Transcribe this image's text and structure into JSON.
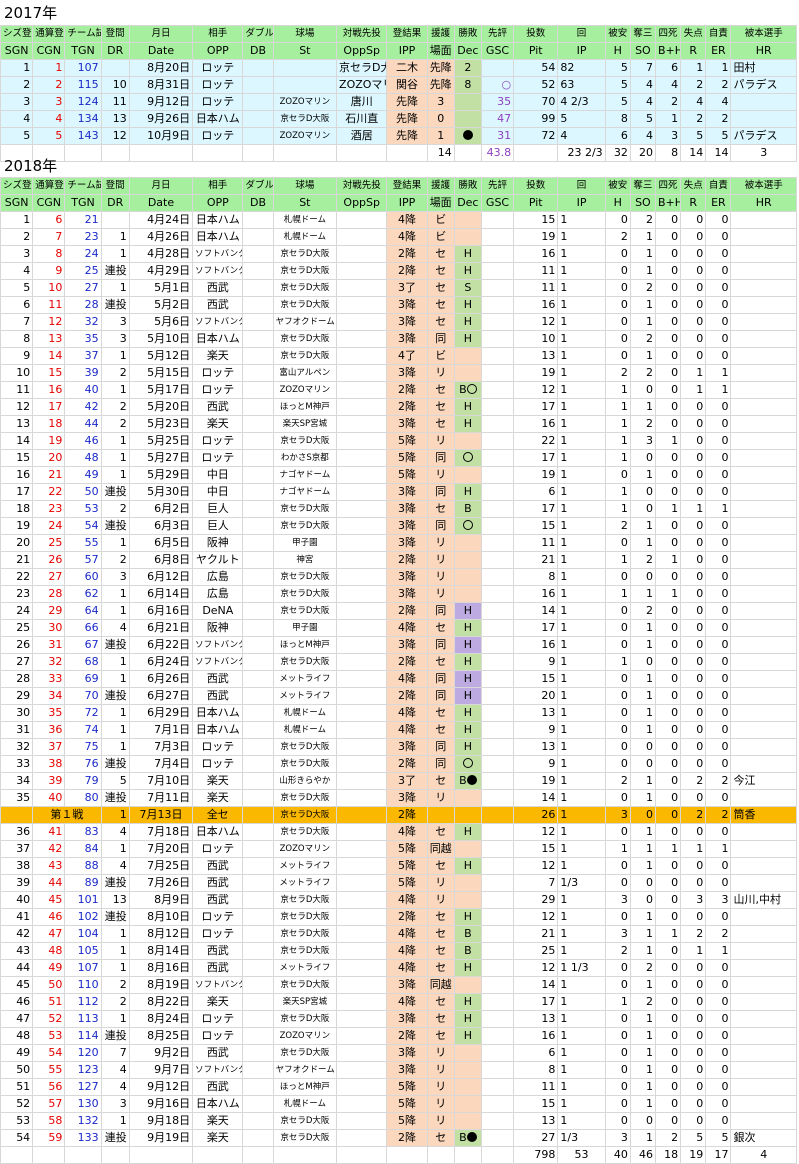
{
  "sec2017": {
    "title": "2017年"
  },
  "sec2018": {
    "title": "2018年"
  },
  "hdr": {
    "jp": [
      "シズ登",
      "通算登",
      "チーム試",
      "登間",
      "月日",
      "相手",
      "ダブル",
      "球場",
      "対戦先投",
      "登結果",
      "援護",
      "勝敗",
      "先評",
      "投数",
      "回",
      "被安",
      "奪三",
      "四死",
      "失点",
      "自責",
      "被本選手"
    ],
    "en": [
      "SGN",
      "CGN",
      "TGN",
      "DR",
      "Date",
      "OPP",
      "DB",
      "St",
      "OppSp",
      "IPP",
      "場面",
      "Dec",
      "GSC",
      "Pit",
      "IP",
      "H",
      "SO",
      "B+H",
      "R",
      "ER",
      "HR"
    ]
  },
  "rows2017": [
    [
      "1",
      "1",
      "107",
      "",
      "8月20日",
      "ロッテ",
      "",
      "京セラD大阪",
      "二木",
      "先降",
      "2",
      "",
      "54",
      "82",
      "5",
      "7",
      "6",
      "1",
      "1",
      "田村"
    ],
    [
      "2",
      "2",
      "115",
      "10",
      "8月31日",
      "ロッテ",
      "",
      "ZOZOマリン",
      "関谷",
      "先降",
      "8",
      "○",
      "52",
      "63",
      "5",
      "4",
      "4",
      "2",
      "2",
      "パラデス"
    ],
    [
      "3",
      "3",
      "124",
      "11",
      "9月12日",
      "ロッテ",
      "",
      "ZOZOマリン",
      "唐川",
      "先降",
      "3",
      "",
      "35",
      "70",
      "4 2/3",
      "5",
      "4",
      "2",
      "4",
      "4",
      ""
    ],
    [
      "4",
      "4",
      "134",
      "13",
      "9月26日",
      "日本ハム",
      "",
      "京セラD大阪",
      "石川直",
      "先降",
      "0",
      "",
      "47",
      "99",
      "5",
      "8",
      "5",
      "1",
      "2",
      "2",
      ""
    ],
    [
      "5",
      "5",
      "143",
      "12",
      "10月9日",
      "ロッテ",
      "",
      "ZOZOマリン",
      "酒居",
      "先降",
      "1",
      "●",
      "31",
      "72",
      "4",
      "6",
      "4",
      "3",
      "5",
      "5",
      "パラデス"
    ]
  ],
  "tot2017": {
    "rs": "14",
    "gsc": "43.8",
    "ip": "23 2/3",
    "h": "32",
    "so": "20",
    "bh": "8",
    "r": "14",
    "er": "14",
    "hr": "3"
  },
  "rows2018": [
    [
      "1",
      "6",
      "21",
      "",
      "4月24日",
      "日本ハム",
      "",
      "札幌ドーム",
      "",
      "4降",
      "ビ",
      "",
      "",
      "15",
      "1",
      "0",
      "2",
      "0",
      "0",
      "0",
      ""
    ],
    [
      "2",
      "7",
      "23",
      "1",
      "4月26日",
      "日本ハム",
      "",
      "札幌ドーム",
      "",
      "4降",
      "ビ",
      "",
      "",
      "19",
      "1",
      "2",
      "1",
      "0",
      "0",
      "0",
      ""
    ],
    [
      "3",
      "8",
      "24",
      "1",
      "4月28日",
      "ソフトバンク",
      "",
      "京セラD大阪",
      "",
      "2降",
      "セ",
      "H",
      "",
      "16",
      "1",
      "0",
      "1",
      "0",
      "0",
      "0",
      ""
    ],
    [
      "4",
      "9",
      "25",
      "連投",
      "4月29日",
      "ソフトバンク",
      "",
      "京セラD大阪",
      "",
      "2降",
      "セ",
      "H",
      "",
      "11",
      "1",
      "0",
      "1",
      "0",
      "0",
      "0",
      ""
    ],
    [
      "5",
      "10",
      "27",
      "1",
      "5月1日",
      "西武",
      "",
      "京セラD大阪",
      "",
      "3了",
      "セ",
      "S",
      "",
      "11",
      "1",
      "0",
      "2",
      "0",
      "0",
      "0",
      ""
    ],
    [
      "6",
      "11",
      "28",
      "連投",
      "5月2日",
      "西武",
      "",
      "京セラD大阪",
      "",
      "3降",
      "セ",
      "H",
      "",
      "16",
      "1",
      "0",
      "1",
      "0",
      "0",
      "0",
      ""
    ],
    [
      "7",
      "12",
      "32",
      "3",
      "5月6日",
      "ソフトバンク",
      "",
      "ヤフオクドーム",
      "",
      "3降",
      "セ",
      "H",
      "",
      "12",
      "1",
      "0",
      "1",
      "0",
      "0",
      "0",
      ""
    ],
    [
      "8",
      "13",
      "35",
      "3",
      "5月10日",
      "日本ハム",
      "",
      "京セラD大阪",
      "",
      "3降",
      "同",
      "H",
      "",
      "10",
      "1",
      "0",
      "2",
      "0",
      "0",
      "0",
      ""
    ],
    [
      "9",
      "14",
      "37",
      "1",
      "5月12日",
      "楽天",
      "",
      "京セラD大阪",
      "",
      "4了",
      "ビ",
      "",
      "",
      "13",
      "1",
      "0",
      "1",
      "0",
      "0",
      "0",
      ""
    ],
    [
      "10",
      "15",
      "39",
      "2",
      "5月15日",
      "ロッテ",
      "",
      "富山アルペン",
      "",
      "3降",
      "リ",
      "",
      "",
      "19",
      "1",
      "2",
      "2",
      "0",
      "1",
      "1",
      ""
    ],
    [
      "11",
      "16",
      "40",
      "1",
      "5月17日",
      "ロッテ",
      "",
      "ZOZOマリン",
      "",
      "2降",
      "セ",
      "B○",
      "",
      "12",
      "1",
      "1",
      "0",
      "0",
      "1",
      "1",
      ""
    ],
    [
      "12",
      "17",
      "42",
      "2",
      "5月20日",
      "西武",
      "",
      "ほっとM神戸",
      "",
      "2降",
      "セ",
      "H",
      "",
      "17",
      "1",
      "1",
      "1",
      "0",
      "0",
      "0",
      ""
    ],
    [
      "13",
      "18",
      "44",
      "2",
      "5月23日",
      "楽天",
      "",
      "楽天SP宮城",
      "",
      "3降",
      "セ",
      "H",
      "",
      "16",
      "1",
      "1",
      "2",
      "0",
      "0",
      "0",
      ""
    ],
    [
      "14",
      "19",
      "46",
      "1",
      "5月25日",
      "ロッテ",
      "",
      "京セラD大阪",
      "",
      "5降",
      "リ",
      "",
      "",
      "22",
      "1",
      "1",
      "3",
      "1",
      "0",
      "0",
      ""
    ],
    [
      "15",
      "20",
      "48",
      "1",
      "5月27日",
      "ロッテ",
      "",
      "わかさS京都",
      "",
      "5降",
      "同",
      "○",
      "",
      "17",
      "1",
      "1",
      "0",
      "0",
      "0",
      "0",
      ""
    ],
    [
      "16",
      "21",
      "49",
      "1",
      "5月29日",
      "中日",
      "",
      "ナゴヤドーム",
      "",
      "5降",
      "リ",
      "",
      "",
      "19",
      "1",
      "0",
      "1",
      "0",
      "0",
      "0",
      ""
    ],
    [
      "17",
      "22",
      "50",
      "連投",
      "5月30日",
      "中日",
      "",
      "ナゴヤドーム",
      "",
      "3降",
      "同",
      "H",
      "",
      "6",
      "1",
      "1",
      "0",
      "0",
      "0",
      "0",
      ""
    ],
    [
      "18",
      "23",
      "53",
      "2",
      "6月2日",
      "巨人",
      "",
      "京セラD大阪",
      "",
      "3降",
      "セ",
      "B",
      "",
      "17",
      "1",
      "1",
      "0",
      "1",
      "1",
      "1",
      ""
    ],
    [
      "19",
      "24",
      "54",
      "連投",
      "6月3日",
      "巨人",
      "",
      "京セラD大阪",
      "",
      "3降",
      "同",
      "○",
      "",
      "15",
      "1",
      "2",
      "1",
      "0",
      "0",
      "0",
      ""
    ],
    [
      "20",
      "25",
      "55",
      "1",
      "6月5日",
      "阪神",
      "",
      "甲子園",
      "",
      "3降",
      "リ",
      "",
      "",
      "11",
      "1",
      "0",
      "1",
      "0",
      "0",
      "0",
      ""
    ],
    [
      "21",
      "26",
      "57",
      "2",
      "6月8日",
      "ヤクルト",
      "",
      "神宮",
      "",
      "2降",
      "リ",
      "",
      "",
      "21",
      "1",
      "1",
      "2",
      "1",
      "0",
      "0",
      ""
    ],
    [
      "22",
      "27",
      "60",
      "3",
      "6月12日",
      "広島",
      "",
      "京セラD大阪",
      "",
      "3降",
      "リ",
      "",
      "",
      "8",
      "1",
      "0",
      "0",
      "0",
      "0",
      "0",
      ""
    ],
    [
      "23",
      "28",
      "62",
      "1",
      "6月14日",
      "広島",
      "",
      "京セラD大阪",
      "",
      "3降",
      "リ",
      "",
      "",
      "16",
      "1",
      "1",
      "1",
      "1",
      "0",
      "0",
      ""
    ],
    [
      "24",
      "29",
      "64",
      "1",
      "6月16日",
      "DeNA",
      "",
      "京セラD大阪",
      "",
      "2降",
      "同",
      "H",
      "",
      "14",
      "1",
      "0",
      "2",
      "0",
      "0",
      "0",
      ""
    ],
    [
      "25",
      "30",
      "66",
      "4",
      "6月21日",
      "阪神",
      "",
      "甲子園",
      "",
      "4降",
      "セ",
      "H",
      "",
      "17",
      "1",
      "0",
      "1",
      "0",
      "0",
      "0",
      ""
    ],
    [
      "26",
      "31",
      "67",
      "連投",
      "6月22日",
      "ソフトバンク",
      "",
      "ほっとM神戸",
      "",
      "3降",
      "同",
      "H",
      "",
      "16",
      "1",
      "0",
      "1",
      "0",
      "0",
      "0",
      ""
    ],
    [
      "27",
      "32",
      "68",
      "1",
      "6月24日",
      "ソフトバンク",
      "",
      "京セラD大阪",
      "",
      "2降",
      "セ",
      "H",
      "",
      "9",
      "1",
      "1",
      "0",
      "0",
      "0",
      "0",
      ""
    ],
    [
      "28",
      "33",
      "69",
      "1",
      "6月26日",
      "西武",
      "",
      "メットライフ",
      "",
      "4降",
      "同",
      "H",
      "",
      "15",
      "1",
      "0",
      "1",
      "0",
      "0",
      "0",
      ""
    ],
    [
      "29",
      "34",
      "70",
      "連投",
      "6月27日",
      "西武",
      "",
      "メットライフ",
      "",
      "2降",
      "同",
      "H",
      "",
      "20",
      "1",
      "0",
      "1",
      "0",
      "0",
      "0",
      ""
    ],
    [
      "30",
      "35",
      "72",
      "1",
      "6月29日",
      "日本ハム",
      "",
      "札幌ドーム",
      "",
      "4降",
      "セ",
      "H",
      "",
      "13",
      "1",
      "0",
      "1",
      "0",
      "0",
      "0",
      ""
    ],
    [
      "31",
      "36",
      "74",
      "1",
      "7月1日",
      "日本ハム",
      "",
      "札幌ドーム",
      "",
      "4降",
      "セ",
      "H",
      "",
      "9",
      "1",
      "0",
      "1",
      "0",
      "0",
      "0",
      ""
    ],
    [
      "32",
      "37",
      "75",
      "1",
      "7月3日",
      "ロッテ",
      "",
      "京セラD大阪",
      "",
      "3降",
      "同",
      "H",
      "",
      "13",
      "1",
      "0",
      "0",
      "0",
      "0",
      "0",
      ""
    ],
    [
      "33",
      "38",
      "76",
      "連投",
      "7月4日",
      "ロッテ",
      "",
      "京セラD大阪",
      "",
      "2降",
      "同",
      "○",
      "",
      "9",
      "1",
      "0",
      "0",
      "0",
      "0",
      "0",
      ""
    ],
    [
      "34",
      "39",
      "79",
      "5",
      "7月10日",
      "楽天",
      "",
      "山形きらやか",
      "",
      "3了",
      "セ",
      "B●",
      "",
      "19",
      "1",
      "2",
      "1",
      "0",
      "2",
      "2",
      "今江"
    ],
    [
      "35",
      "40",
      "80",
      "連投",
      "7月11日",
      "楽天",
      "",
      "京セラD大阪",
      "",
      "3降",
      "リ",
      "",
      "",
      "14",
      "1",
      "0",
      "1",
      "0",
      "0",
      "0",
      ""
    ]
  ],
  "asg": [
    "第１戦",
    "1",
    "7月13日",
    "全セ",
    "京セラD大阪",
    "2降",
    "26",
    "1",
    "3",
    "0",
    "0",
    "2",
    "2",
    "筒香"
  ],
  "rows2018b": [
    [
      "36",
      "41",
      "83",
      "4",
      "7月18日",
      "日本ハム",
      "",
      "京セラD大阪",
      "",
      "4降",
      "セ",
      "H",
      "",
      "12",
      "1",
      "0",
      "1",
      "0",
      "0",
      "0",
      ""
    ],
    [
      "37",
      "42",
      "84",
      "1",
      "7月20日",
      "ロッテ",
      "",
      "ZOZOマリン",
      "",
      "5降",
      "同越",
      "",
      "",
      "15",
      "1",
      "1",
      "1",
      "1",
      "1",
      "1",
      ""
    ],
    [
      "38",
      "43",
      "88",
      "4",
      "7月25日",
      "西武",
      "",
      "メットライフ",
      "",
      "5降",
      "セ",
      "H",
      "",
      "12",
      "1",
      "0",
      "1",
      "0",
      "0",
      "0",
      ""
    ],
    [
      "39",
      "44",
      "89",
      "連投",
      "7月26日",
      "西武",
      "",
      "メットライフ",
      "",
      "5降",
      "リ",
      "",
      "",
      "7",
      "1/3",
      "0",
      "0",
      "0",
      "0",
      "0",
      ""
    ],
    [
      "40",
      "45",
      "101",
      "13",
      "8月9日",
      "西武",
      "",
      "京セラD大阪",
      "",
      "4降",
      "リ",
      "",
      "",
      "29",
      "1",
      "3",
      "0",
      "0",
      "3",
      "3",
      "山川,中村"
    ],
    [
      "41",
      "46",
      "102",
      "連投",
      "8月10日",
      "ロッテ",
      "",
      "京セラD大阪",
      "",
      "2降",
      "セ",
      "H",
      "",
      "12",
      "1",
      "0",
      "1",
      "0",
      "0",
      "0",
      ""
    ],
    [
      "42",
      "47",
      "104",
      "1",
      "8月12日",
      "ロッテ",
      "",
      "京セラD大阪",
      "",
      "4降",
      "セ",
      "B",
      "",
      "21",
      "1",
      "3",
      "1",
      "1",
      "2",
      "2",
      ""
    ],
    [
      "43",
      "48",
      "105",
      "1",
      "8月14日",
      "西武",
      "",
      "京セラD大阪",
      "",
      "4降",
      "セ",
      "B",
      "",
      "25",
      "1",
      "2",
      "1",
      "0",
      "1",
      "1",
      ""
    ],
    [
      "44",
      "49",
      "107",
      "1",
      "8月16日",
      "西武",
      "",
      "メットライフ",
      "",
      "4降",
      "セ",
      "H",
      "",
      "12",
      "1 1/3",
      "0",
      "2",
      "0",
      "0",
      "0",
      ""
    ],
    [
      "45",
      "50",
      "110",
      "2",
      "8月19日",
      "ソフトバンク",
      "",
      "京セラD大阪",
      "",
      "3降",
      "同越",
      "",
      "",
      "14",
      "1",
      "0",
      "1",
      "0",
      "0",
      "0",
      ""
    ],
    [
      "46",
      "51",
      "112",
      "2",
      "8月22日",
      "楽天",
      "",
      "楽天SP宮城",
      "",
      "4降",
      "セ",
      "H",
      "",
      "17",
      "1",
      "1",
      "2",
      "0",
      "0",
      "0",
      ""
    ],
    [
      "47",
      "52",
      "113",
      "1",
      "8月24日",
      "ロッテ",
      "",
      "京セラD大阪",
      "",
      "3降",
      "セ",
      "H",
      "",
      "13",
      "1",
      "0",
      "1",
      "0",
      "0",
      "0",
      ""
    ],
    [
      "48",
      "53",
      "114",
      "連投",
      "8月25日",
      "ロッテ",
      "",
      "ZOZOマリン",
      "",
      "2降",
      "セ",
      "H",
      "",
      "16",
      "1",
      "0",
      "1",
      "0",
      "0",
      "0",
      ""
    ],
    [
      "49",
      "54",
      "120",
      "7",
      "9月2日",
      "西武",
      "",
      "京セラD大阪",
      "",
      "3降",
      "リ",
      "",
      "",
      "6",
      "1",
      "0",
      "1",
      "0",
      "0",
      "0",
      ""
    ],
    [
      "50",
      "55",
      "123",
      "4",
      "9月7日",
      "ソフトバンク",
      "",
      "ヤフオクドーム",
      "",
      "3降",
      "リ",
      "",
      "",
      "8",
      "1",
      "0",
      "1",
      "0",
      "0",
      "0",
      ""
    ],
    [
      "51",
      "56",
      "127",
      "4",
      "9月12日",
      "西武",
      "",
      "ほっとM神戸",
      "",
      "5降",
      "リ",
      "",
      "",
      "11",
      "1",
      "0",
      "1",
      "0",
      "0",
      "0",
      ""
    ],
    [
      "52",
      "57",
      "130",
      "3",
      "9月16日",
      "日本ハム",
      "",
      "札幌ドーム",
      "",
      "5降",
      "リ",
      "",
      "",
      "15",
      "1",
      "0",
      "1",
      "0",
      "0",
      "0",
      ""
    ],
    [
      "53",
      "58",
      "132",
      "1",
      "9月18日",
      "楽天",
      "",
      "京セラD大阪",
      "",
      "5降",
      "リ",
      "",
      "",
      "13",
      "1",
      "0",
      "0",
      "0",
      "0",
      "0",
      ""
    ],
    [
      "54",
      "59",
      "133",
      "連投",
      "9月19日",
      "楽天",
      "",
      "京セラD大阪",
      "",
      "2降",
      "セ",
      "B●",
      "",
      "27",
      "1/3",
      "3",
      "1",
      "2",
      "5",
      "5",
      "銀次"
    ]
  ],
  "tot2018": {
    "pit": "798",
    "ip": "53",
    "h": "40",
    "so": "46",
    "bh": "18",
    "r": "19",
    "er": "17",
    "hr": "4"
  }
}
